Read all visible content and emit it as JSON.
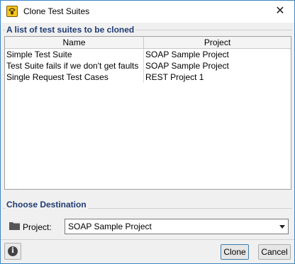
{
  "window": {
    "title": "Clone Test Suites",
    "close_symbol": "✕"
  },
  "suites_group": {
    "title": "A list of test suites to be cloned",
    "columns": [
      "Name",
      "Project"
    ],
    "rows": [
      {
        "name": "Simple Test Suite",
        "project": "SOAP Sample Project"
      },
      {
        "name": "Test Suite fails if we don't get faults",
        "project": "SOAP Sample Project"
      },
      {
        "name": "Single Request Test Cases",
        "project": "REST Project 1"
      }
    ]
  },
  "destination_group": {
    "title": "Choose Destination",
    "project_label": "Project:",
    "project_value": "SOAP Sample Project"
  },
  "footer": {
    "info_symbol": "i",
    "clone_label": "Clone",
    "cancel_label": "Cancel"
  },
  "icons": {
    "app": "soapui-app-icon",
    "folder": "folder-icon",
    "info": "info-icon",
    "dropdown": "chevron-down-icon",
    "close": "close-icon"
  },
  "colors": {
    "group_title": "#1f3b73",
    "window_border": "#3c86c4",
    "app_icon": "#f3c623"
  }
}
